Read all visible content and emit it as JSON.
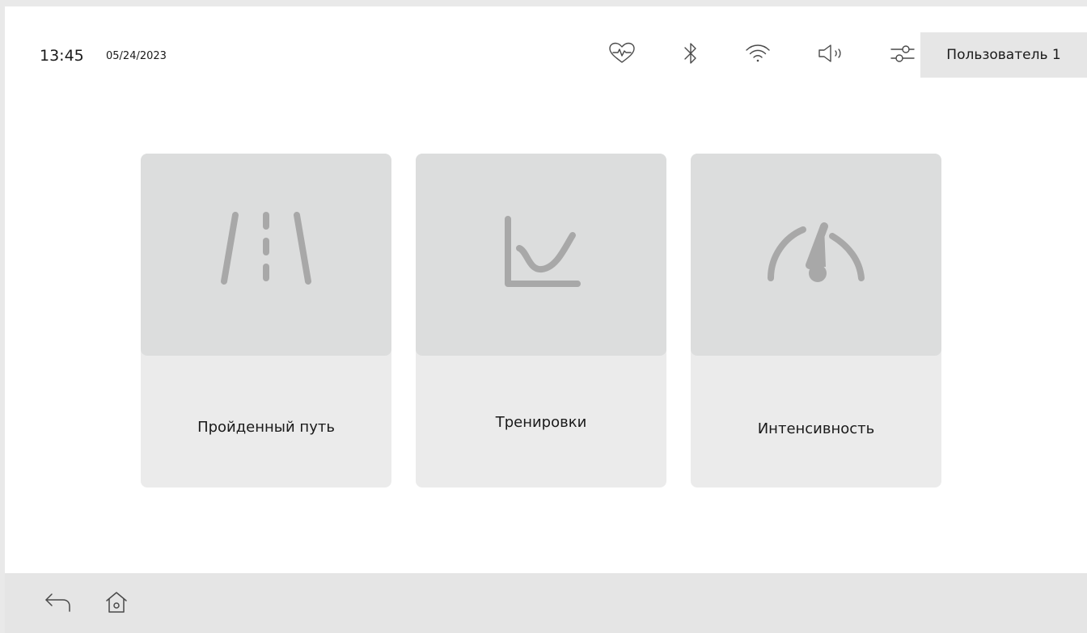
{
  "status_bar": {
    "time": "13:45",
    "date": "05/24/2023",
    "icons": [
      "heart-rate-icon",
      "bluetooth-icon",
      "wifi-icon",
      "volume-icon",
      "settings-sliders-icon"
    ],
    "user_label": "Пользователь 1"
  },
  "tiles": [
    {
      "label": "Пройденный путь",
      "icon": "road-icon"
    },
    {
      "label": "Тренировки",
      "icon": "chart-icon"
    },
    {
      "label": "Интенсивность",
      "icon": "speedometer-icon"
    }
  ],
  "bottom_bar": {
    "icons": [
      "back-icon",
      "home-icon"
    ]
  },
  "colors": {
    "tile_top": "#dcdddd",
    "tile_bottom": "#ebebeb",
    "icon_gray": "#a8a8a8",
    "bottom_bar": "#e5e5e5"
  }
}
